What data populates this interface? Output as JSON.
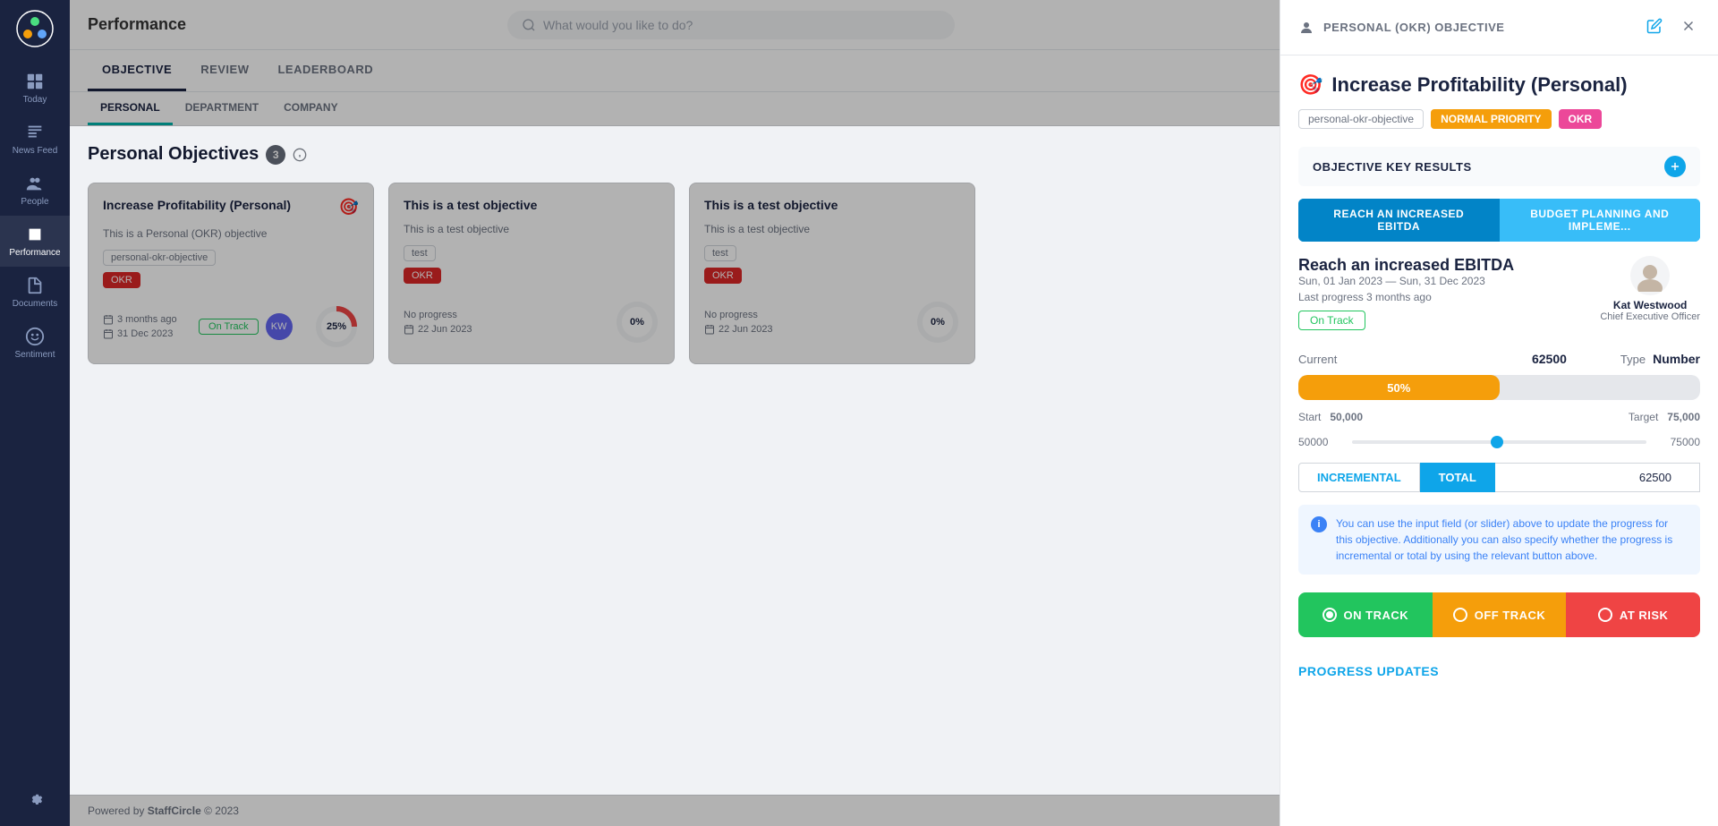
{
  "app": {
    "title": "Performance",
    "search_placeholder": "What would you like to do?"
  },
  "sidebar": {
    "logo_alt": "StaffCircle Logo",
    "items": [
      {
        "id": "today",
        "label": "Today",
        "icon": "grid-icon",
        "active": false
      },
      {
        "id": "newsfeed",
        "label": "News Feed",
        "icon": "news-icon",
        "active": false
      },
      {
        "id": "people",
        "label": "People",
        "icon": "people-icon",
        "active": false
      },
      {
        "id": "performance",
        "label": "Performance",
        "icon": "performance-icon",
        "active": true
      },
      {
        "id": "documents",
        "label": "Documents",
        "icon": "documents-icon",
        "active": false
      },
      {
        "id": "sentiment",
        "label": "Sentiment",
        "icon": "sentiment-icon",
        "active": false
      }
    ],
    "settings_label": "Settings"
  },
  "tabs": {
    "main": [
      {
        "id": "objective",
        "label": "OBJECTIVE",
        "active": true
      },
      {
        "id": "review",
        "label": "REVIEW",
        "active": false
      },
      {
        "id": "leaderboard",
        "label": "LEADERBOARD",
        "active": false
      }
    ],
    "sub": [
      {
        "id": "personal",
        "label": "PERSONAL",
        "active": true
      },
      {
        "id": "department",
        "label": "DEPARTMENT",
        "active": false
      },
      {
        "id": "company",
        "label": "COMPANY",
        "active": false
      }
    ]
  },
  "page": {
    "heading": "Personal Objectives",
    "count": "3"
  },
  "objective_cards": [
    {
      "id": 1,
      "title": "Increase Profitability (Personal)",
      "description": "This is a Personal (OKR) objective",
      "tag": "personal-okr-objective",
      "badge": "OKR",
      "date_icon": "calendar-icon",
      "time_ago": "3 months ago",
      "due_date": "31 Dec 2023",
      "status": "On Track",
      "progress": "25%"
    },
    {
      "id": 2,
      "title": "This is a test objective",
      "description": "This is a test objective",
      "tag": "test",
      "badge": "OKR",
      "date_icon": "calendar-icon",
      "time_ago": "No progress",
      "due_date": "22 Jun 2023",
      "status": "",
      "progress": "0%"
    },
    {
      "id": 3,
      "title": "This is a test objective",
      "description": "This is a test objective",
      "tag": "test",
      "badge": "OKR",
      "date_icon": "calendar-icon",
      "time_ago": "No progress",
      "due_date": "22 Jun 2023",
      "status": "",
      "progress": "0%"
    }
  ],
  "footer": {
    "powered_by": "Powered by",
    "brand": "StaffCircle",
    "year": "© 2023"
  },
  "panel": {
    "header_label": "PERSONAL (OKR) OBJECTIVE",
    "edit_icon": "edit-icon",
    "close_icon": "close-icon",
    "title": "Increase Profitability (Personal)",
    "title_icon": "🎯",
    "tags": [
      {
        "id": "tag1",
        "label": "personal-okr-objective",
        "type": "outline"
      },
      {
        "id": "tag2",
        "label": "NORMAL PRIORITY",
        "type": "normal-priority"
      },
      {
        "id": "tag3",
        "label": "OKR",
        "type": "okr-tag"
      }
    ],
    "key_results_section": "OBJECTIVE KEY RESULTS",
    "kr_tabs": [
      {
        "id": "ebitda",
        "label": "REACH AN INCREASED EBITDA",
        "active": true
      },
      {
        "id": "budget",
        "label": "BUDGET PLANNING AND IMPLEME...",
        "active": false
      }
    ],
    "kr": {
      "title": "Reach an increased EBITDA",
      "date_range": "Sun, 01 Jan 2023 — Sun, 31 Dec 2023",
      "last_progress": "Last progress 3 months ago",
      "status": "On Track",
      "owner_name": "Kat Westwood",
      "owner_role": "Chief Executive Officer",
      "current_label": "Current",
      "current_value": "62500",
      "type_label": "Type",
      "type_value": "Number",
      "progress_pct": "50%",
      "progress_fill": 50,
      "start_label": "Start",
      "start_value": "50,000",
      "target_label": "Target",
      "target_value": "75,000",
      "slider_min": "50000",
      "slider_max": "75000",
      "incremental_label": "INCREMENTAL",
      "total_label": "TOTAL",
      "total_value": "62500",
      "info_text": "You can use the input field (or slider) above to update the progress for this objective. Additionally you can also specify whether the progress is incremental or total by using the relevant button above.",
      "status_buttons": [
        {
          "id": "on-track",
          "label": "ON TRACK",
          "type": "on-track-btn",
          "checked": true
        },
        {
          "id": "off-track",
          "label": "OFF TRACK",
          "type": "off-track-btn",
          "checked": false
        },
        {
          "id": "at-risk",
          "label": "AT RISK",
          "type": "at-risk-btn",
          "checked": false
        }
      ],
      "progress_updates_label": "PROGRESS UPDATES"
    }
  }
}
